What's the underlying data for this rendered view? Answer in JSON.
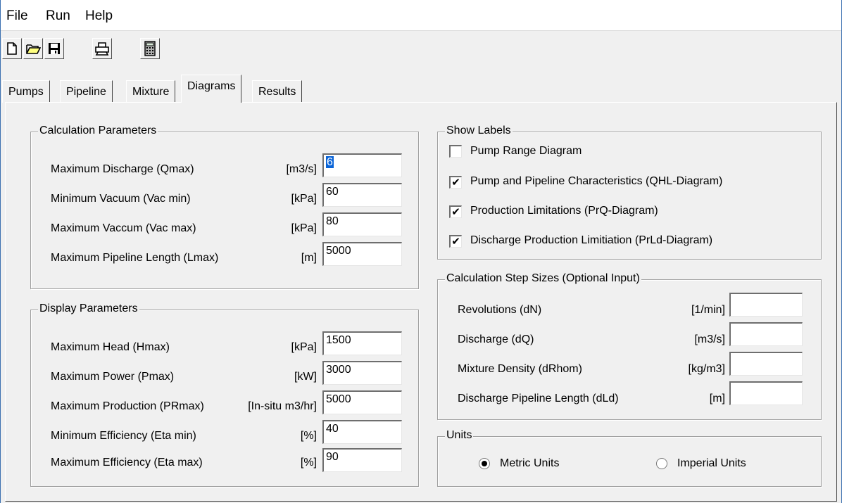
{
  "menu": [
    "File",
    "Run",
    "Help"
  ],
  "toolbar": {
    "icons": [
      "new-file-icon",
      "open-folder-icon",
      "save-icon",
      "print-icon",
      "calculator-icon"
    ]
  },
  "tabs": [
    {
      "label": "Pumps",
      "active": false
    },
    {
      "label": "Pipeline",
      "active": false
    },
    {
      "label": "Mixture",
      "active": false
    },
    {
      "label": "Diagrams",
      "active": true
    },
    {
      "label": "Results",
      "active": false
    }
  ],
  "calc_params": {
    "title": "Calculation Parameters",
    "rows": [
      {
        "label": "Maximum Discharge (Qmax)",
        "unit": "[m3/s]",
        "value": "6"
      },
      {
        "label": "Minimum Vacuum (Vac min)",
        "unit": "[kPa]",
        "value": "60"
      },
      {
        "label": "Maximum Vaccum (Vac max)",
        "unit": "[kPa]",
        "value": "80"
      },
      {
        "label": "Maximum Pipeline Length (Lmax)",
        "unit": "[m]",
        "value": "5000"
      }
    ]
  },
  "display_params": {
    "title": "Display Parameters",
    "rows": [
      {
        "label": "Maximum Head (Hmax)",
        "unit": "[kPa]",
        "value": "1500"
      },
      {
        "label": "Maximum Power (Pmax)",
        "unit": "[kW]",
        "value": "3000"
      },
      {
        "label": "Maximum Production (PRmax)",
        "unit": "[In-situ m3/hr]",
        "value": "5000"
      },
      {
        "label": "Minimum Efficiency (Eta min)",
        "unit": "[%]",
        "value": "40"
      },
      {
        "label": "Maximum Efficiency (Eta max)",
        "unit": "[%]",
        "value": "90"
      }
    ]
  },
  "show_labels": {
    "title": "Show Labels",
    "items": [
      {
        "label": "Pump Range Diagram",
        "checked": false
      },
      {
        "label": "Pump and Pipeline Characteristics (QHL-Diagram)",
        "checked": true
      },
      {
        "label": "Production Limitations (PrQ-Diagram)",
        "checked": true
      },
      {
        "label": "Discharge Production Limitiation (PrLd-Diagram)",
        "checked": true
      }
    ]
  },
  "step_sizes": {
    "title": "Calculation Step Sizes (Optional Input)",
    "rows": [
      {
        "label": "Revolutions (dN)",
        "unit": "[1/min]",
        "value": ""
      },
      {
        "label": "Discharge (dQ)",
        "unit": "[m3/s]",
        "value": ""
      },
      {
        "label": "Mixture Density (dRhom)",
        "unit": "[kg/m3]",
        "value": ""
      },
      {
        "label": "Discharge Pipeline Length (dLd)",
        "unit": "[m]",
        "value": ""
      }
    ]
  },
  "units": {
    "title": "Units",
    "options": [
      {
        "label": "Metric Units",
        "selected": true
      },
      {
        "label": "Imperial Units",
        "selected": false
      }
    ]
  }
}
